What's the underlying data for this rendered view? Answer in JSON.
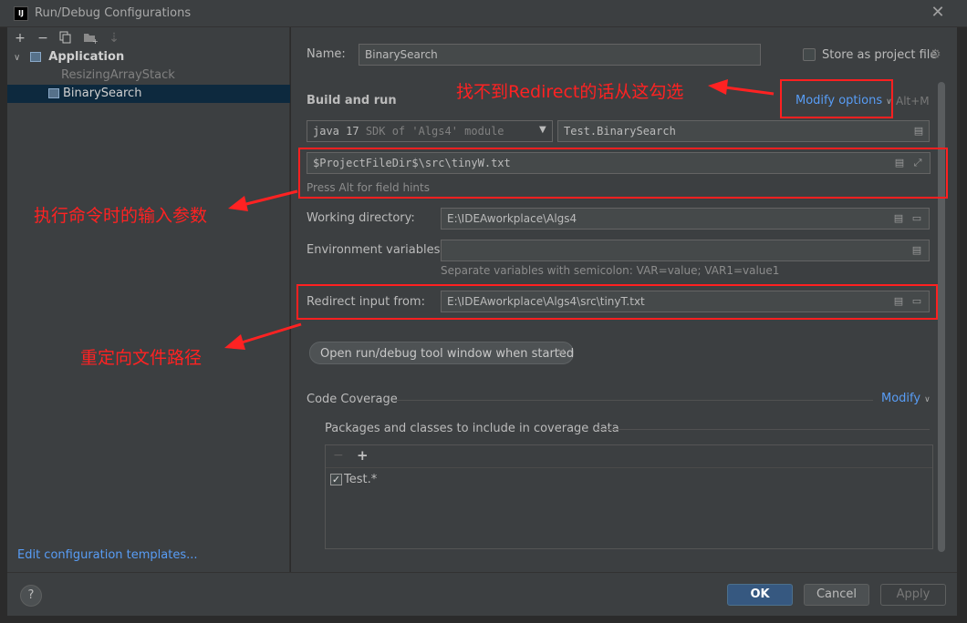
{
  "window": {
    "title": "Run/Debug Configurations",
    "app_icon": "IJ"
  },
  "tree": {
    "application_label": "Application",
    "items": [
      {
        "label": "ResizingArrayStack"
      },
      {
        "label": "BinarySearch"
      }
    ]
  },
  "left_footer": {
    "edit_templates": "Edit configuration templates..."
  },
  "form": {
    "name_label": "Name:",
    "name_value": "BinarySearch",
    "store_label": "Store as project file",
    "build_run_title": "Build and run",
    "modify_options": "Modify options",
    "modify_shortcut": "Alt+M",
    "jdk_java": "java 17",
    "jdk_desc": "SDK of 'Algs4' module",
    "main_class": "Test.BinarySearch",
    "program_args": "$ProjectFileDir$\\src\\tinyW.txt",
    "field_hint": "Press Alt for field hints",
    "working_dir_label": "Working directory:",
    "working_dir_value": "E:\\IDEAworkplace\\Algs4",
    "env_label": "Environment variables:",
    "env_hint": "Separate variables with semicolon: VAR=value; VAR1=value1",
    "redirect_label": "Redirect input from:",
    "redirect_value": "E:\\IDEAworkplace\\Algs4\\src\\tinyT.txt",
    "tool_window_chip": "Open run/debug tool window when started",
    "coverage_title": "Code Coverage",
    "coverage_modify": "Modify",
    "packages_title": "Packages and classes to include in coverage data",
    "coverage_items": [
      {
        "label": "Test.*",
        "checked": true
      }
    ]
  },
  "buttons": {
    "ok": "OK",
    "cancel": "Cancel",
    "apply": "Apply",
    "help": "?"
  },
  "annotations": {
    "modify_note": "找不到Redirect的话从这勾选",
    "args_note": "执行命令时的输入参数",
    "redirect_note": "重定向文件路径"
  },
  "colors": {
    "annotation": "#ff2222",
    "link": "#589df6",
    "selection": "#0d293e"
  }
}
